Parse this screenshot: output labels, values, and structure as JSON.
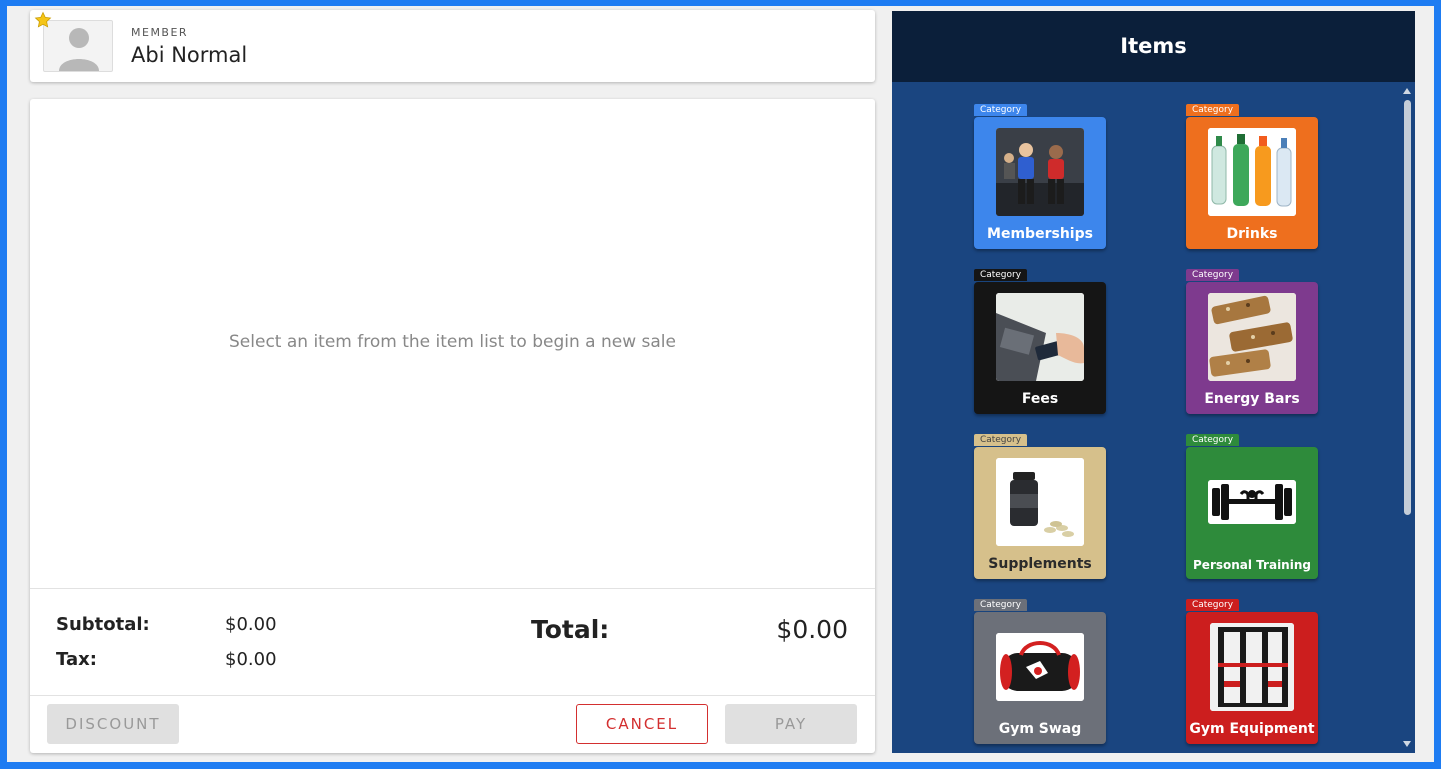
{
  "member": {
    "label": "MEMBER",
    "name": "Abi Normal"
  },
  "sale": {
    "empty_message": "Select an item from the item list to begin a new sale",
    "subtotal_label": "Subtotal:",
    "subtotal_value": "$0.00",
    "tax_label": "Tax:",
    "tax_value": "$0.00",
    "total_label": "Total:",
    "total_value": "$0.00"
  },
  "actions": {
    "discount": "DISCOUNT",
    "cancel": "CANCEL",
    "pay": "PAY"
  },
  "items_panel": {
    "title": "Items",
    "tiles": [
      {
        "tag": "Category",
        "label": "Memberships",
        "color": "#3d86ec",
        "tag_color": "#3d86ec",
        "icon": "gym-class-photo"
      },
      {
        "tag": "Category",
        "label": "Drinks",
        "color": "#ee6f1e",
        "tag_color": "#ee6f1e",
        "icon": "bottles-photo"
      },
      {
        "tag": "Category",
        "label": "Fees",
        "color": "#151515",
        "tag_color": "#151515",
        "icon": "card-terminal-photo"
      },
      {
        "tag": "Category",
        "label": "Energy Bars",
        "color": "#7e3a8e",
        "tag_color": "#7e3a8e",
        "icon": "energy-bars-photo"
      },
      {
        "tag": "Category",
        "label": "Supplements",
        "color": "#d6c08b",
        "tag_color": "#d6c08b",
        "icon": "supplement-bottle-photo"
      },
      {
        "tag": "Category",
        "label": "Personal Training",
        "color": "#2e8b3b",
        "tag_color": "#2e8b3b",
        "icon": "barbell-icon"
      },
      {
        "tag": "Category",
        "label": "Gym Swag",
        "color": "#6c7079",
        "tag_color": "#6c7079",
        "icon": "gym-bag-photo"
      },
      {
        "tag": "Category",
        "label": "Gym Equipment",
        "color": "#cc1e1e",
        "tag_color": "#cc1e1e",
        "icon": "power-rack-photo"
      }
    ]
  }
}
